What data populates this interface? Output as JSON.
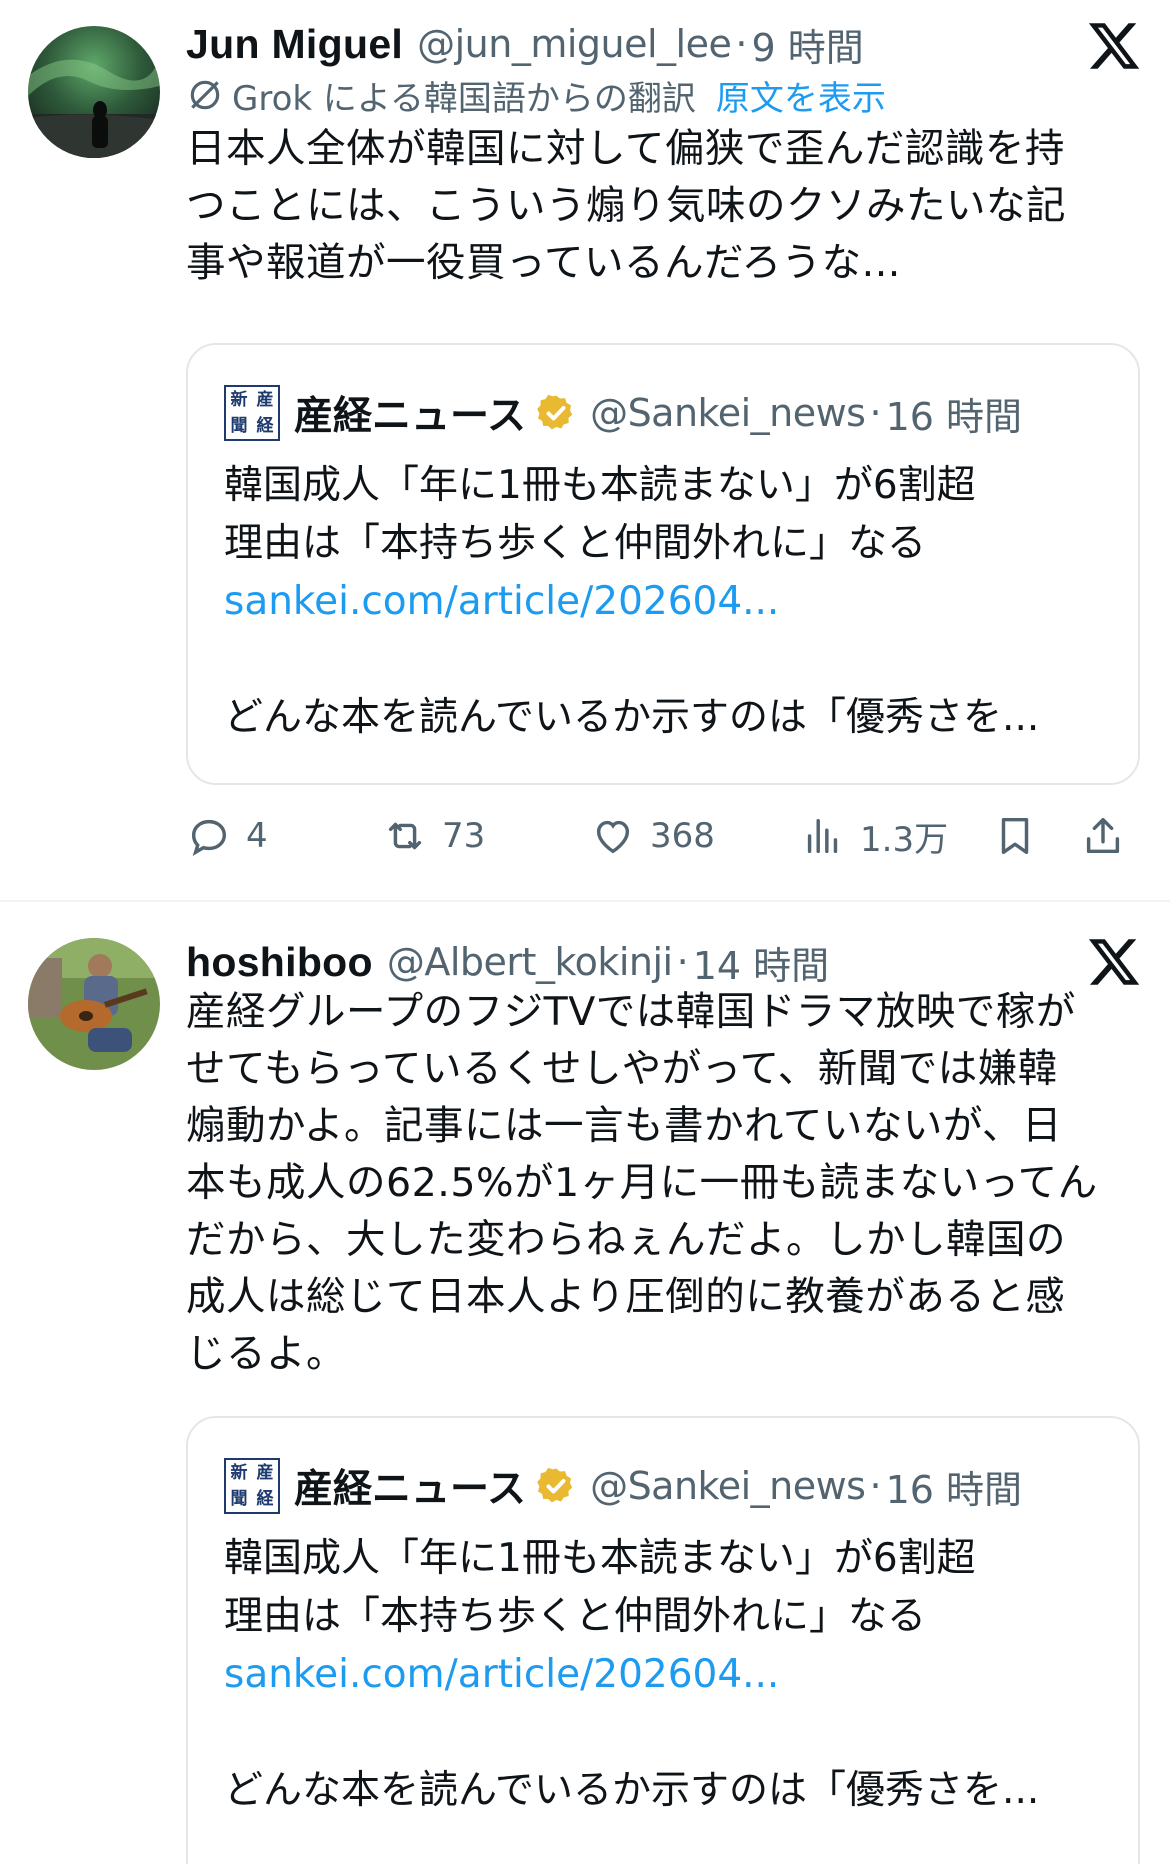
{
  "tweets": [
    {
      "name": "Jun Miguel",
      "handle": "@jun_miguel_lee",
      "separator": "·",
      "time": "9 時間",
      "translation": {
        "label": "Grok による韓国語からの翻訳",
        "show_original": "原文を表示"
      },
      "text_lines": [
        "日本人全体が韓国に対して偏狭で歪んだ認識を持",
        "つことには、こういう煽り気味のクソみたいな記",
        "事や報道が一役買っているんだろうな..."
      ],
      "quote": {
        "logo_chars": [
          "新",
          "産",
          "聞",
          "経"
        ],
        "name": "産経ニュース",
        "handle": "@Sankei_news",
        "separator": "·",
        "time": "16 時間",
        "lines": [
          "韓国成人「年に1冊も本読まない」が6割超",
          "理由は「本持ち歩くと仲間外れに」なる"
        ],
        "link": "sankei.com/article/202604...",
        "last_line": "どんな本を読んでいるか示すのは「優秀さを..."
      },
      "actions": {
        "reply": "4",
        "retweet": "73",
        "like": "368",
        "views": "1.3万"
      }
    },
    {
      "name": "hoshiboo",
      "handle": "@Albert_kokinji",
      "separator": "·",
      "time": "14 時間",
      "text_lines": [
        "産経グループのフジTVでは韓国ドラマ放映で稼が",
        "せてもらっているくせしやがって、新聞では嫌韓",
        "煽動かよ。記事には一言も書かれていないが、日",
        "本も成人の62.5%が1ヶ月に一冊も読まないってん",
        "だから、大した変わらねぇんだよ。しかし韓国の",
        "成人は総じて日本人より圧倒的に教養があると感",
        "じるよ。"
      ],
      "quote": {
        "logo_chars": [
          "新",
          "産",
          "聞",
          "経"
        ],
        "name": "産経ニュース",
        "handle": "@Sankei_news",
        "separator": "·",
        "time": "16 時間",
        "lines": [
          "韓国成人「年に1冊も本読まない」が6割超",
          "理由は「本持ち歩くと仲間外れに」なる"
        ],
        "link": "sankei.com/article/202604...",
        "last_line": "どんな本を読んでいるか示すのは「優秀さを..."
      }
    }
  ],
  "colors": {
    "text": "#0f1419",
    "secondary": "#536471",
    "link": "#1d9bf0",
    "verified_gold": "#e8b931",
    "border": "#e4e7ea"
  },
  "icons": [
    "x-logo-icon",
    "grok-icon",
    "verified-badge-icon",
    "reply-icon",
    "retweet-icon",
    "like-icon",
    "views-icon",
    "bookmark-icon",
    "share-icon"
  ]
}
